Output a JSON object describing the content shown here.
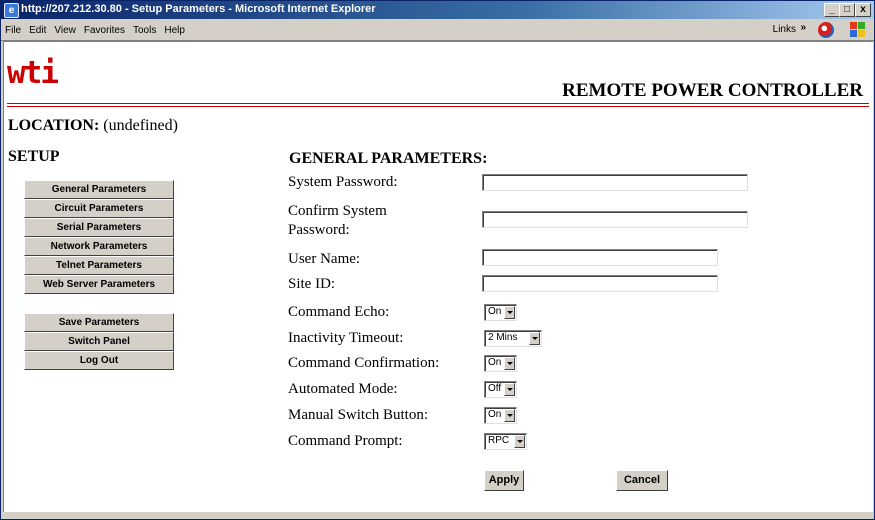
{
  "window": {
    "title": "http://207.212.30.80 - Setup Parameters - Microsoft Internet Explorer",
    "minimize": "_",
    "maximize": "□",
    "close": "x"
  },
  "menubar": {
    "items": [
      "File",
      "Edit",
      "View",
      "Favorites",
      "Tools",
      "Help"
    ],
    "links_label": "Links",
    "links_chevron": "»"
  },
  "header": {
    "logo_text": "wti",
    "title": "REMOTE POWER CONTROLLER",
    "accent_color": "#cc0000"
  },
  "location": {
    "label": "LOCATION:",
    "value": "(undefined)"
  },
  "sidebar": {
    "title": "SETUP",
    "group1": [
      "General Parameters",
      "Circuit Parameters",
      "Serial Parameters",
      "Network Parameters",
      "Telnet Parameters",
      "Web Server Parameters"
    ],
    "group2": [
      "Save Parameters",
      "Switch Panel",
      "Log Out"
    ]
  },
  "form": {
    "title": "GENERAL PARAMETERS:",
    "system_password_label": "System Password:",
    "confirm_password_label_line1": "Confirm System",
    "confirm_password_label_line2": "Password:",
    "user_name_label": "User Name:",
    "site_id_label": "Site ID:",
    "command_echo_label": "Command Echo:",
    "command_echo_value": "On",
    "inactivity_timeout_label": "Inactivity Timeout:",
    "inactivity_timeout_value": "2 Mins",
    "command_confirmation_label": "Command Confirmation:",
    "command_confirmation_value": "On",
    "automated_mode_label": "Automated Mode:",
    "automated_mode_value": "Off",
    "manual_switch_label": "Manual Switch Button:",
    "manual_switch_value": "On",
    "command_prompt_label": "Command Prompt:",
    "command_prompt_value": "RPC",
    "apply_label": "Apply",
    "cancel_label": "Cancel"
  }
}
